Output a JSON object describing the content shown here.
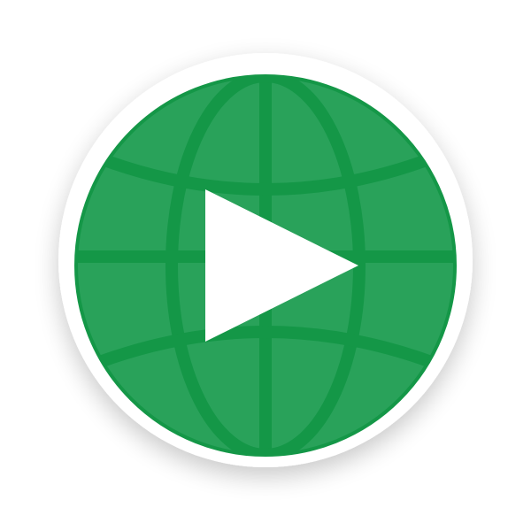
{
  "icon": {
    "name": "globe-play-icon",
    "description_colors": {
      "badge_background": "#ffffff",
      "globe_fill": "#29A25A",
      "globe_grid_lines": "#149747",
      "play_triangle": "#ffffff"
    }
  }
}
